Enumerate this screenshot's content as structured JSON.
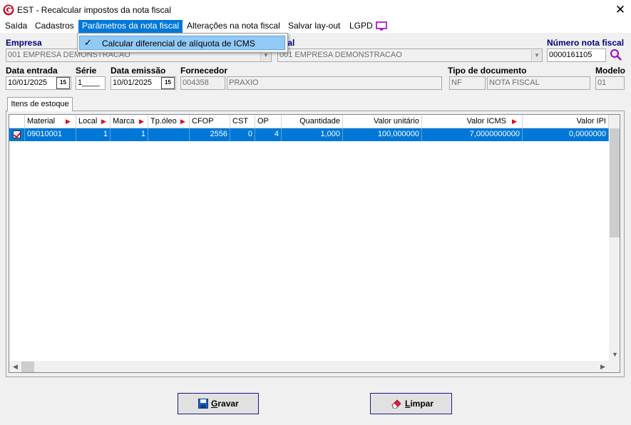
{
  "window": {
    "title": "EST - Recalcular impostos da nota fiscal",
    "close_label": "✕"
  },
  "menu": {
    "items": [
      {
        "label": "Saída"
      },
      {
        "label": "Cadastros"
      },
      {
        "label": "Parâmetros da nota fiscal"
      },
      {
        "label": "Alterações na nota fiscal"
      },
      {
        "label": "Salvar lay-out"
      },
      {
        "label": "LGPD"
      }
    ],
    "dropdown": {
      "item_label": "Calcular diferencial de alíquota de ICMS",
      "checked": true
    }
  },
  "form": {
    "empresa": {
      "label": "Empresa",
      "value": "001 EMPRESA DEMONSTRACAO"
    },
    "filial": {
      "label": "ial",
      "value": "001 EMPRESA DEMONSTRACAO"
    },
    "numero_nota": {
      "label": "Número nota fiscal",
      "value": "0000161105"
    },
    "data_entrada": {
      "label": "Data entrada",
      "value": "10/01/2025"
    },
    "serie": {
      "label": "Série",
      "value": "1____"
    },
    "data_emissao": {
      "label": "Data emissão",
      "value": "10/01/2025"
    },
    "fornecedor": {
      "label": "Fornecedor",
      "code": "004358",
      "name": "PRAXIO"
    },
    "tipo_documento": {
      "label": "Tipo de documento",
      "code": "NF",
      "name": "NOTA FISCAL"
    },
    "modelo": {
      "label": "Modelo",
      "value": "01"
    },
    "calendar_label": "15"
  },
  "tab": {
    "label": "Itens de estoque"
  },
  "grid": {
    "columns": [
      "Material",
      "Local",
      "Marca",
      "Tp.óleo",
      "CFOP",
      "CST",
      "OP",
      "Quantidade",
      "Valor unitário",
      "Valor ICMS",
      "Valor IPI"
    ],
    "rows": [
      {
        "material": "09010001",
        "local": "1",
        "marca": "1",
        "tp_oleo": "",
        "cfop": "2556",
        "cst": "0",
        "op": "4",
        "quantidade": "1,000",
        "valor_unitario": "100,000000",
        "valor_icms": "7,0000000000",
        "valor_ipi": "0,0000000"
      }
    ]
  },
  "buttons": {
    "gravar": {
      "label_first": "G",
      "label_rest": "ravar"
    },
    "limpar": {
      "label_first": "L",
      "label_rest": "impar"
    }
  },
  "colors": {
    "selection": "#0078d7",
    "label_blue": "#000080",
    "sort_arrow": "#e0001b",
    "lgpd_icon": "#a000c8"
  }
}
